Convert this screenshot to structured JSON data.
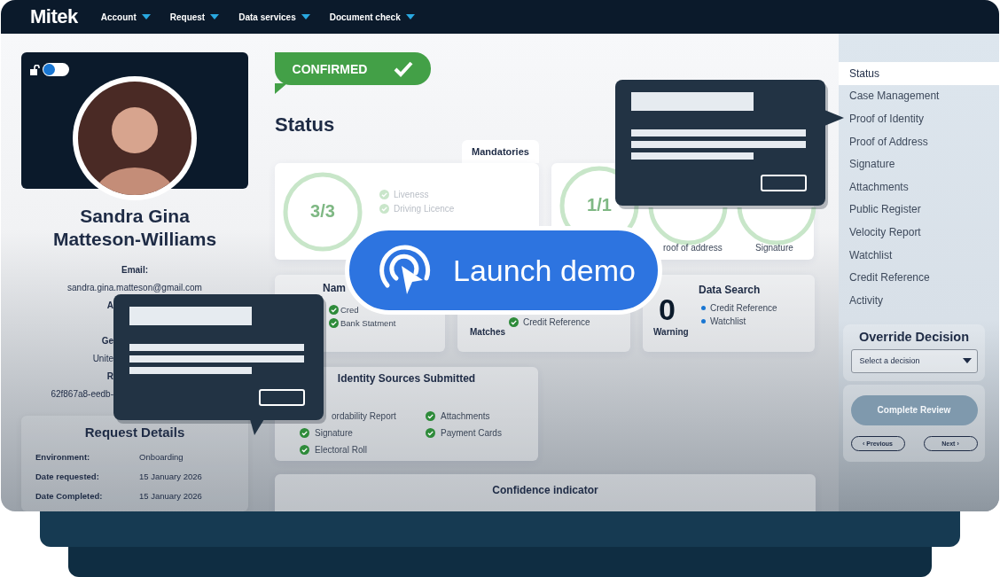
{
  "nav": {
    "logo": "Mitek",
    "menus": [
      {
        "label": "Account"
      },
      {
        "label": "Request"
      },
      {
        "label": "Data services"
      },
      {
        "label": "Document check"
      }
    ]
  },
  "profile": {
    "lock_toggle": {
      "on": false
    },
    "name_lines": [
      "Sandra Gina",
      "Matteson-Williams"
    ],
    "rows": [
      {
        "text": "Email:",
        "kind": "label"
      },
      {
        "text": "sandra.gina.matteson@gmail.com",
        "kind": "value"
      },
      {
        "text": "A",
        "kind": "cut_label"
      },
      {
        "kind": "hidden"
      },
      {
        "text": "Ge",
        "kind": "cut_label"
      },
      {
        "text": "Unite",
        "kind": "cut_value"
      },
      {
        "text": "R",
        "kind": "cut_label"
      },
      {
        "text": "62f867a8-eedb-",
        "kind": "cut_value"
      }
    ]
  },
  "request_details": {
    "title": "Request Details",
    "rows": [
      {
        "label": "Environment:",
        "value": "Onboarding"
      },
      {
        "label": "Date requested:",
        "value": "15 January 2026"
      },
      {
        "label": "Date Completed:",
        "value": "15 January 2026"
      }
    ]
  },
  "status": {
    "badge": "CONFIRMED",
    "heading": "Status",
    "tab": "Mandatories",
    "mandatories": {
      "score": "3/3",
      "items": [
        "Liveness",
        "Driving Licence"
      ]
    },
    "rings": [
      {
        "score": "1/1"
      },
      {
        "label": "roof of address"
      },
      {
        "label": "Signature"
      }
    ]
  },
  "summary_cards": [
    {
      "kind": "checks",
      "title": "Nam",
      "items": [
        "Cred",
        "Bank Statment"
      ]
    },
    {
      "kind": "matches",
      "label": "Matches",
      "items": [
        "Credit Reference"
      ]
    },
    {
      "kind": "data_search",
      "count": "0",
      "label": "Warning",
      "title": "Data Search",
      "items": [
        "Credit Reference",
        "Watchlist"
      ]
    }
  ],
  "identity_sources": {
    "title": "Identity Sources Submitted",
    "columns": [
      [
        {
          "label": "ordability Report",
          "checked": false
        },
        {
          "label": "Signature",
          "checked": true
        },
        {
          "label": "Electoral Roll",
          "checked": true
        }
      ],
      [
        {
          "label": "Attachments",
          "checked": true
        },
        {
          "label": "Payment Cards",
          "checked": true
        }
      ]
    ]
  },
  "confidence": {
    "title": "Confidence indicator"
  },
  "sidebar": {
    "items": [
      {
        "label": "Status",
        "selected": true
      },
      {
        "label": "Case Management",
        "selected": false
      },
      {
        "label": "Proof of Identity",
        "selected": false
      },
      {
        "label": "Proof of Address",
        "selected": false
      },
      {
        "label": "Signature",
        "selected": false
      },
      {
        "label": "Attachments",
        "selected": false
      },
      {
        "label": "Public Register",
        "selected": false
      },
      {
        "label": "Velocity Report",
        "selected": false
      },
      {
        "label": "Watchlist",
        "selected": false
      },
      {
        "label": "Credit Reference",
        "selected": false
      },
      {
        "label": "Activity",
        "selected": false
      }
    ],
    "override": {
      "title": "Override Decision",
      "placeholder": "Select a decision"
    },
    "complete": {
      "label": "Complete Review",
      "disabled": true
    },
    "previous": "‹ Previous",
    "next": "Next ›"
  },
  "launch_button": {
    "label": "Launch demo"
  },
  "popovers": [
    {
      "kind": "pointer_down"
    },
    {
      "kind": "pointer_right"
    }
  ]
}
